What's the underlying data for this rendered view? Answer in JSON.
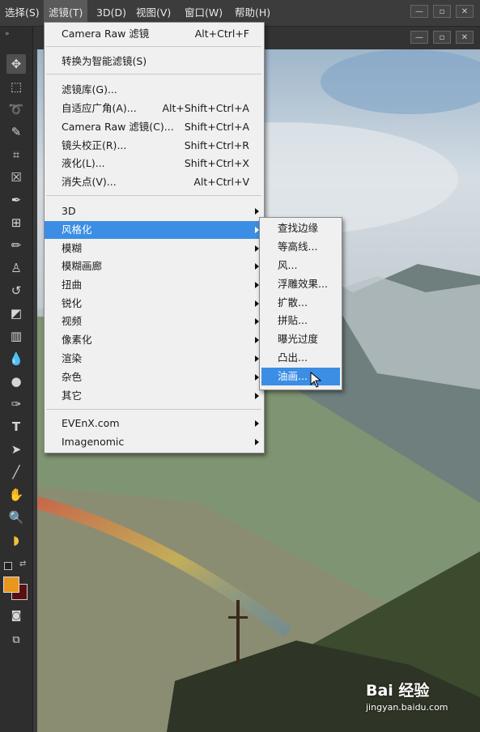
{
  "menubar": {
    "items": [
      {
        "label": "选择(S)"
      },
      {
        "label": "滤镜(T)"
      },
      {
        "label": "3D(D)"
      },
      {
        "label": "视图(V)"
      },
      {
        "label": "窗口(W)"
      },
      {
        "label": "帮助(H)"
      }
    ],
    "active_item": "滤镜(T)"
  },
  "window_controls": [
    "minimize-icon",
    "restore-icon",
    "close-icon"
  ],
  "toolbar": {
    "tools": [
      "move-icon",
      "marquee-icon",
      "lasso-icon",
      "quick-select-icon",
      "crop-icon",
      "frame-icon",
      "eyedropper-icon",
      "healing-icon",
      "brush-icon",
      "stamp-icon",
      "history-brush-icon",
      "eraser-icon",
      "gradient-icon",
      "blur-icon",
      "dodge-icon",
      "pen-icon",
      "type-icon",
      "path-select-icon",
      "line-icon",
      "hand-icon",
      "zoom-icon",
      "banana-icon"
    ],
    "type_tool_glyph": "T",
    "foreground_color": "#e8961c",
    "background_color": "#5a1010"
  },
  "filter_menu": {
    "items": [
      {
        "label": "Camera Raw 滤镜",
        "shortcut": "Alt+Ctrl+F"
      },
      {
        "label": "转换为智能滤镜(S)",
        "shortcut": ""
      },
      {
        "label": "滤镜库(G)...",
        "shortcut": ""
      },
      {
        "label": "自适应广角(A)...",
        "shortcut": "Alt+Shift+Ctrl+A"
      },
      {
        "label": "Camera Raw 滤镜(C)...",
        "shortcut": "Shift+Ctrl+A"
      },
      {
        "label": "镜头校正(R)...",
        "shortcut": "Shift+Ctrl+R"
      },
      {
        "label": "液化(L)...",
        "shortcut": "Shift+Ctrl+X"
      },
      {
        "label": "消失点(V)...",
        "shortcut": "Alt+Ctrl+V"
      },
      {
        "label": "3D",
        "submenu": true
      },
      {
        "label": "风格化",
        "submenu": true,
        "highlighted": true
      },
      {
        "label": "模糊",
        "submenu": true
      },
      {
        "label": "模糊画廊",
        "submenu": true
      },
      {
        "label": "扭曲",
        "submenu": true
      },
      {
        "label": "锐化",
        "submenu": true
      },
      {
        "label": "视频",
        "submenu": true
      },
      {
        "label": "像素化",
        "submenu": true
      },
      {
        "label": "渲染",
        "submenu": true
      },
      {
        "label": "杂色",
        "submenu": true
      },
      {
        "label": "其它",
        "submenu": true
      },
      {
        "label": "EVEnX.com",
        "submenu": true
      },
      {
        "label": "Imagenomic",
        "submenu": true
      }
    ]
  },
  "stylize_submenu": {
    "items": [
      {
        "label": "查找边缘"
      },
      {
        "label": "等高线..."
      },
      {
        "label": "风..."
      },
      {
        "label": "浮雕效果..."
      },
      {
        "label": "扩散..."
      },
      {
        "label": "拼贴..."
      },
      {
        "label": "曝光过度"
      },
      {
        "label": "凸出..."
      },
      {
        "label": "油画...",
        "highlighted": true
      }
    ]
  },
  "watermark": {
    "main": "Bai 经验",
    "sub": "jingyan.baidu.com"
  }
}
